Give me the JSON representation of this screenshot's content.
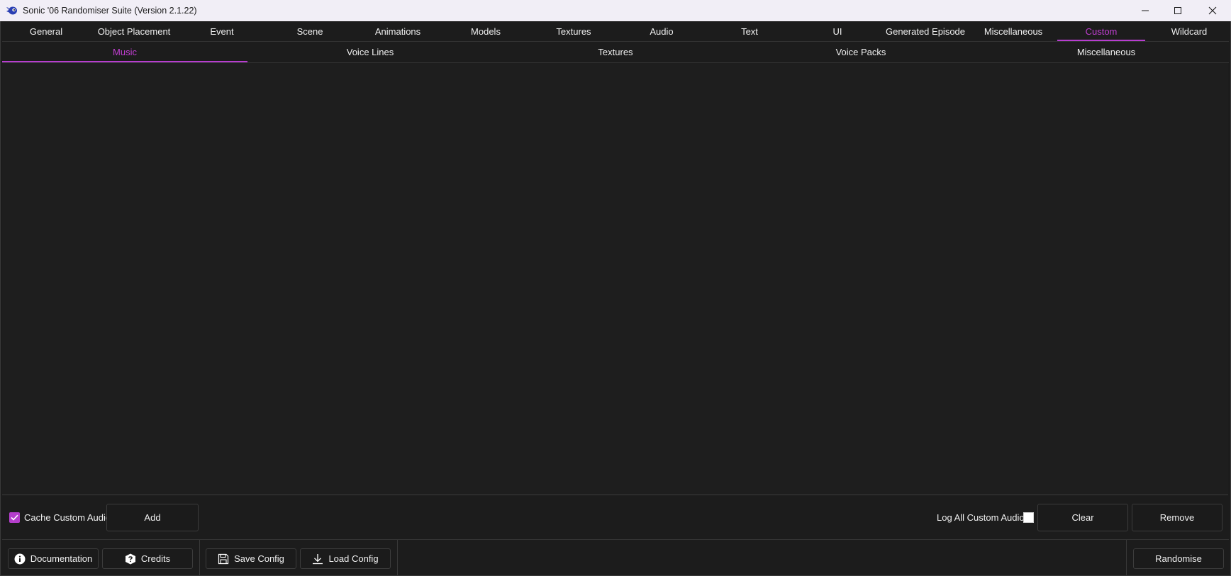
{
  "window": {
    "title": "Sonic '06 Randomiser Suite (Version 2.1.22)",
    "app_icon": "sonic-app-icon",
    "controls": {
      "minimize": "minimize-icon",
      "maximize": "maximize-icon",
      "close": "close-icon"
    }
  },
  "main_tabs": [
    {
      "label": "General"
    },
    {
      "label": "Object Placement"
    },
    {
      "label": "Event"
    },
    {
      "label": "Scene"
    },
    {
      "label": "Animations"
    },
    {
      "label": "Models"
    },
    {
      "label": "Textures"
    },
    {
      "label": "Audio"
    },
    {
      "label": "Text"
    },
    {
      "label": "UI"
    },
    {
      "label": "Generated Episode"
    },
    {
      "label": "Miscellaneous"
    },
    {
      "label": "Custom"
    },
    {
      "label": "Wildcard"
    }
  ],
  "main_tabs_active": "Custom",
  "sub_tabs": [
    {
      "label": "Music"
    },
    {
      "label": "Voice Lines"
    },
    {
      "label": "Textures"
    },
    {
      "label": "Voice Packs"
    },
    {
      "label": "Miscellaneous"
    }
  ],
  "sub_tabs_active": "Music",
  "actions": {
    "cache_custom_audio": {
      "label": "Cache Custom Audio",
      "checked": true
    },
    "add_label": "Add",
    "log_all_custom_audio": {
      "label": "Log All Custom Audio",
      "checked": false
    },
    "clear_label": "Clear",
    "remove_label": "Remove"
  },
  "bottom": {
    "documentation_label": "Documentation",
    "credits_label": "Credits",
    "save_config_label": "Save Config",
    "load_config_label": "Load Config",
    "randomise_label": "Randomise"
  },
  "colors": {
    "accent": "#b73dcf",
    "accent_text": "#c23fd3",
    "background": "#1c1c1c",
    "titlebar": "#f1eef6"
  }
}
